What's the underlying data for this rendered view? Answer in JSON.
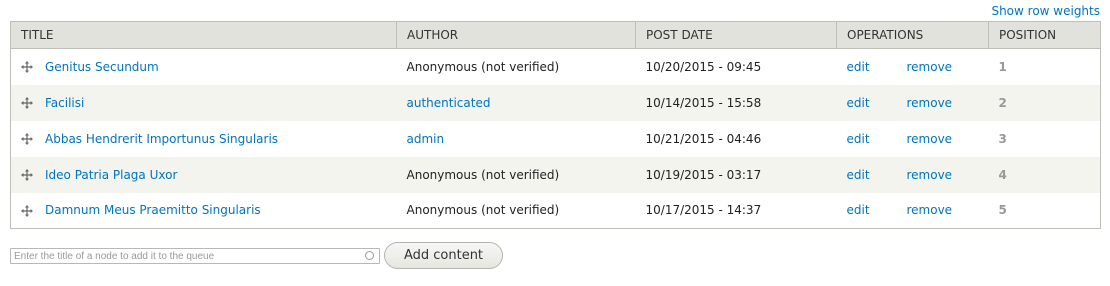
{
  "header_link": "Show row weights",
  "columns": [
    "TITLE",
    "AUTHOR",
    "POST DATE",
    "OPERATIONS",
    "POSITION"
  ],
  "rows": [
    {
      "title": "Genitus Secundum",
      "author": "Anonymous (not verified)",
      "author_is_link": false,
      "post_date": "10/20/2015 - 09:45",
      "edit": "edit",
      "remove": "remove",
      "position": "1"
    },
    {
      "title": "Facilisi",
      "author": "authenticated",
      "author_is_link": true,
      "post_date": "10/14/2015 - 15:58",
      "edit": "edit",
      "remove": "remove",
      "position": "2"
    },
    {
      "title": "Abbas Hendrerit Importunus Singularis",
      "author": "admin",
      "author_is_link": true,
      "post_date": "10/21/2015 - 04:46",
      "edit": "edit",
      "remove": "remove",
      "position": "3"
    },
    {
      "title": "Ideo Patria Plaga Uxor",
      "author": "Anonymous (not verified)",
      "author_is_link": false,
      "post_date": "10/19/2015 - 03:17",
      "edit": "edit",
      "remove": "remove",
      "position": "4"
    },
    {
      "title": "Damnum Meus Praemitto Singularis",
      "author": "Anonymous (not verified)",
      "author_is_link": false,
      "post_date": "10/17/2015 - 14:37",
      "edit": "edit",
      "remove": "remove",
      "position": "5"
    }
  ],
  "add_form": {
    "placeholder": "Enter the title of a node to add it to the queue",
    "value": "",
    "button_label": "Add content"
  },
  "colors": {
    "link": "#0074bd",
    "header_bg": "#e1e2dc",
    "stripe_bg": "#f3f4ee",
    "border": "#bfbfba",
    "position_text": "#999999"
  },
  "icons": {
    "drag_handle": "move-arrows-icon",
    "autocomplete": "throbber-circle-icon"
  }
}
